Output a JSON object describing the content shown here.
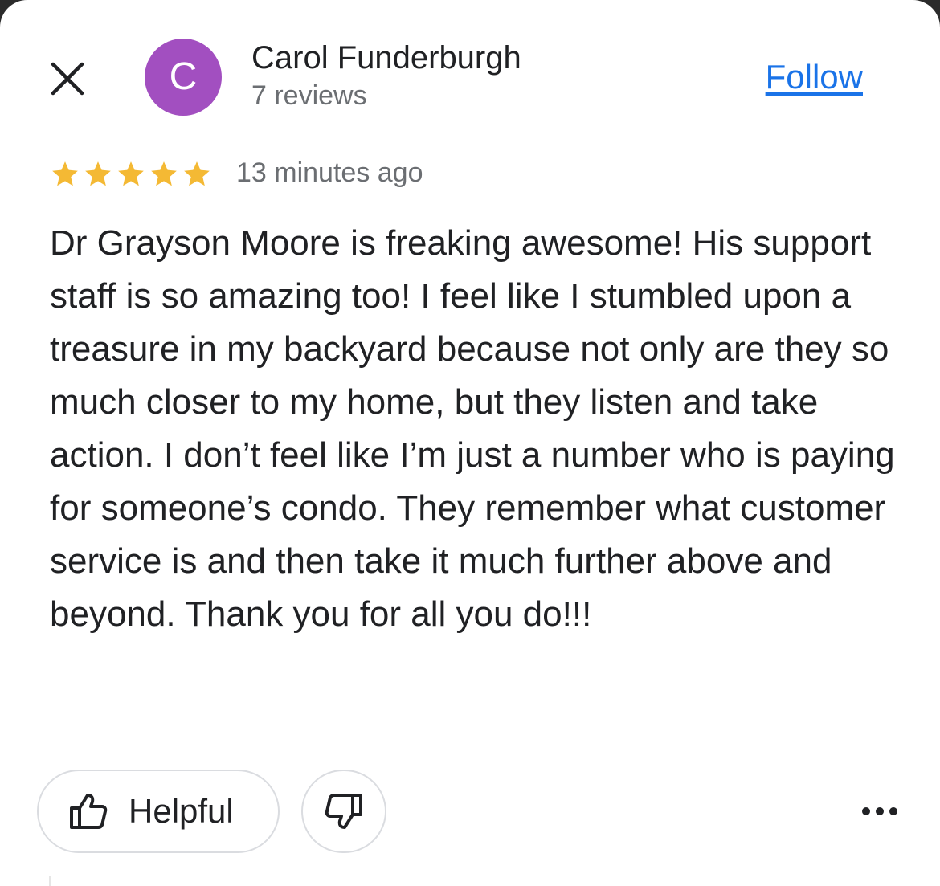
{
  "icons": {
    "close": "close-icon",
    "thumbs_up": "thumbs-up-icon",
    "thumbs_down": "thumbs-down-icon",
    "more": "more-horizontal-icon",
    "star": "star-icon"
  },
  "colors": {
    "avatar_bg": "#a24fc0",
    "link": "#1a73e8",
    "star": "#f4b934",
    "text": "#202124",
    "secondary_text": "#6b6e72"
  },
  "header": {
    "avatar_initial": "C",
    "author_name": "Carol Funderburgh",
    "review_count": "7 reviews",
    "follow_label": "Follow"
  },
  "review": {
    "rating": 5,
    "rating_max": 5,
    "time_ago": "13 minutes ago",
    "text": "Dr Grayson Moore is freaking awesome!  His support staff is so amazing too!  I feel like I stumbled upon a treasure in my backyard because not only are they so much closer to my home, but they listen and take action. I don’t feel like I’m just a number who is paying for someone’s condo. They remember what customer service is and then take it much further above and beyond.  Thank you for all you do!!!"
  },
  "actions": {
    "helpful_label": "Helpful"
  }
}
